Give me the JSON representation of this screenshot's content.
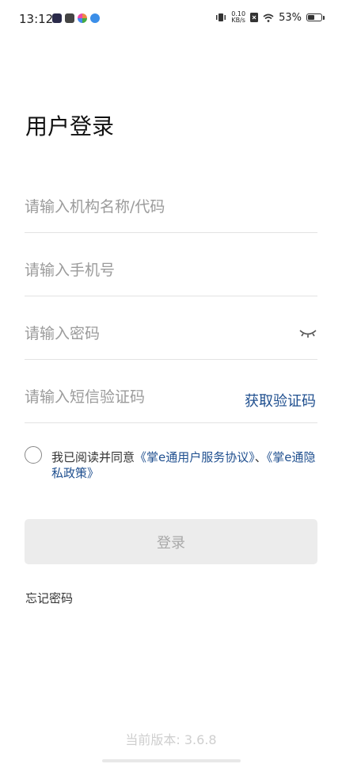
{
  "status_bar": {
    "time": "13:12",
    "net_speed_value": "0.10",
    "net_speed_unit": "KB/s",
    "battery": "53%",
    "battery_level": 0.53
  },
  "page": {
    "title": "用户登录"
  },
  "form": {
    "org_placeholder": "请输入机构名称/代码",
    "phone_placeholder": "请输入手机号",
    "password_placeholder": "请输入密码",
    "sms_placeholder": "请输入短信验证码",
    "get_code_label": "获取验证码"
  },
  "agreement": {
    "prefix": "我已阅读并同意",
    "link1": "《掌e通用户服务协议》",
    "separator": "、",
    "link2": "《掌e通隐私政策》"
  },
  "actions": {
    "login_label": "登录",
    "forgot_label": "忘记密码"
  },
  "footer": {
    "version": "当前版本: 3.6.8"
  },
  "colors": {
    "link": "#1f4f8f",
    "button_bg": "#ececec",
    "button_text": "#a8a8a8"
  }
}
